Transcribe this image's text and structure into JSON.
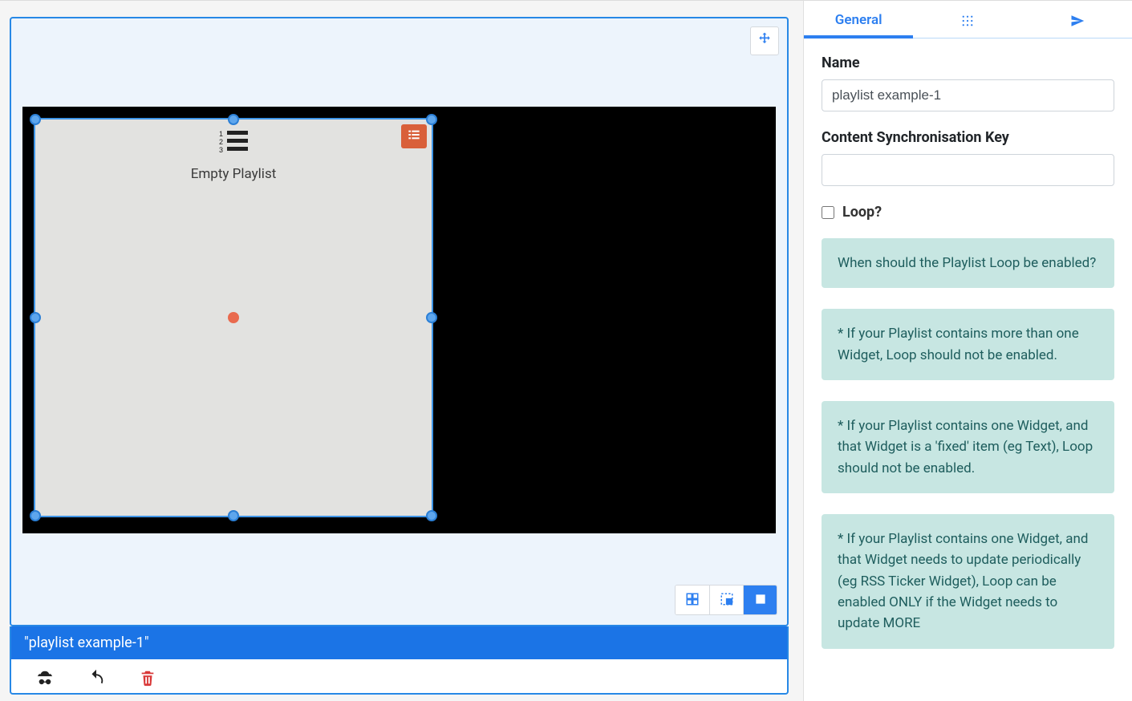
{
  "canvas": {
    "region_label": "Empty Playlist"
  },
  "footer": {
    "title": "\"playlist example-1\""
  },
  "tabs": {
    "general": "General"
  },
  "form": {
    "name_label": "Name",
    "name_value": "playlist example-1",
    "sync_label": "Content Synchronisation Key",
    "sync_value": "",
    "loop_label": "Loop?"
  },
  "hints": [
    "When should the Playlist Loop be enabled?",
    "* If your Playlist contains more than one Widget, Loop should not be enabled.",
    "* If your Playlist contains one Widget, and that Widget is a 'fixed' item (eg Text), Loop should not be enabled.",
    "* If your Playlist contains one Widget, and that Widget needs to update periodically (eg RSS Ticker Widget), Loop can be enabled ONLY if the Widget needs to update MORE"
  ]
}
